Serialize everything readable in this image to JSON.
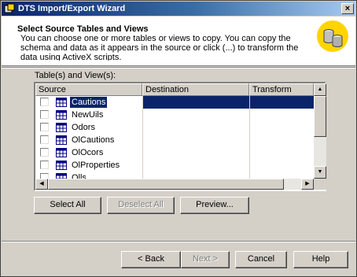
{
  "window": {
    "title": "DTS Import/Export Wizard",
    "close_label": "×"
  },
  "header": {
    "title": "Select Source Tables and Views",
    "description": "You can choose one or more tables or views to copy.  You can copy the schema and data as it appears in the source or click (...) to transform the data using ActiveX scripts.",
    "icon": "database-cylinders-icon"
  },
  "grid": {
    "label": "Table(s) and View(s):",
    "columns": [
      "Source",
      "Destination",
      "Transform"
    ],
    "rows": [
      {
        "checked": false,
        "selected": true,
        "source": "Cautions",
        "destination": "",
        "transform": ""
      },
      {
        "checked": false,
        "selected": false,
        "source": "NewUils",
        "destination": "",
        "transform": ""
      },
      {
        "checked": false,
        "selected": false,
        "source": "Odors",
        "destination": "",
        "transform": ""
      },
      {
        "checked": false,
        "selected": false,
        "source": "OlCautions",
        "destination": "",
        "transform": ""
      },
      {
        "checked": false,
        "selected": false,
        "source": "OlOcors",
        "destination": "",
        "transform": ""
      },
      {
        "checked": false,
        "selected": false,
        "source": "OlProperties",
        "destination": "",
        "transform": ""
      },
      {
        "checked": false,
        "selected": false,
        "source": "Olls",
        "destination": "",
        "transform": ""
      }
    ]
  },
  "actions": {
    "select_all": "Select All",
    "deselect_all": "Deselect All",
    "preview": "Preview..."
  },
  "footer": {
    "back": "< Back",
    "next": "Next >",
    "cancel": "Cancel",
    "help": "Help"
  },
  "colors": {
    "titlebar": "#0a246a",
    "selection": "#0a246a",
    "face": "#d4d0c8"
  }
}
